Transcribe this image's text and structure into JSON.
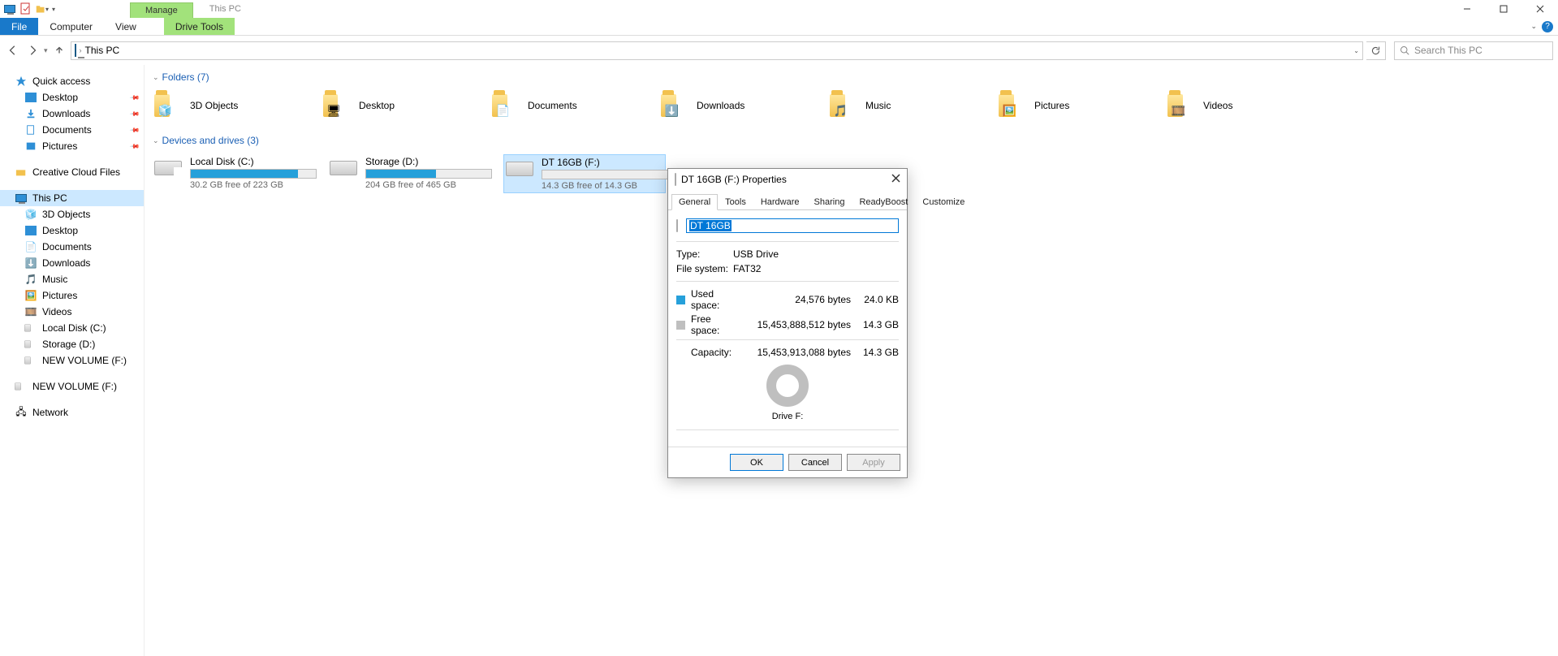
{
  "window": {
    "title": "This PC",
    "ribbon_context_group": "Manage",
    "controls": {
      "min": "Minimize",
      "max": "Restore",
      "close": "Close"
    }
  },
  "ribbon": {
    "file": "File",
    "tabs": [
      "Computer",
      "View"
    ],
    "context_tabs": [
      "Drive Tools"
    ]
  },
  "address": {
    "location": "This PC",
    "search_placeholder": "Search This PC"
  },
  "navpane": {
    "quick_access": "Quick access",
    "quick_items": [
      {
        "label": "Desktop",
        "pin": true
      },
      {
        "label": "Downloads",
        "pin": true
      },
      {
        "label": "Documents",
        "pin": true
      },
      {
        "label": "Pictures",
        "pin": true
      }
    ],
    "creative": "Creative Cloud Files",
    "this_pc": "This PC",
    "pc_children": [
      "3D Objects",
      "Desktop",
      "Documents",
      "Downloads",
      "Music",
      "Pictures",
      "Videos",
      "Local Disk (C:)",
      "Storage (D:)",
      "NEW VOLUME (F:)"
    ],
    "loose": [
      "NEW VOLUME (F:)"
    ],
    "network": "Network"
  },
  "content": {
    "folders_header": "Folders (7)",
    "folders": [
      "3D Objects",
      "Desktop",
      "Documents",
      "Downloads",
      "Music",
      "Pictures",
      "Videos"
    ],
    "drives_header": "Devices and drives (3)",
    "drives": [
      {
        "label": "Local Disk (C:)",
        "free_text": "30.2 GB free of 223 GB",
        "fill_pct": 86
      },
      {
        "label": "Storage (D:)",
        "free_text": "204 GB free of 465 GB",
        "fill_pct": 56
      },
      {
        "label": "DT 16GB (F:)",
        "free_text": "14.3 GB free of 14.3 GB",
        "fill_pct": 0,
        "selected": true
      }
    ]
  },
  "dialog": {
    "title": "DT 16GB (F:) Properties",
    "tabs": [
      "General",
      "Tools",
      "Hardware",
      "Sharing",
      "ReadyBoost",
      "Customize"
    ],
    "active_tab": "General",
    "name_value": "DT 16GB",
    "type_label": "Type:",
    "type_value": "USB Drive",
    "fs_label": "File system:",
    "fs_value": "FAT32",
    "used_label": "Used space:",
    "used_bytes": "24,576 bytes",
    "used_h": "24.0 KB",
    "free_label": "Free space:",
    "free_bytes": "15,453,888,512 bytes",
    "free_h": "14.3 GB",
    "cap_label": "Capacity:",
    "cap_bytes": "15,453,913,088 bytes",
    "cap_h": "14.3 GB",
    "drive_label": "Drive F:",
    "buttons": {
      "ok": "OK",
      "cancel": "Cancel",
      "apply": "Apply"
    }
  }
}
